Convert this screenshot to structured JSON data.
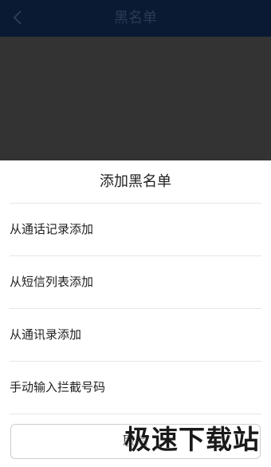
{
  "header": {
    "title": "黑名单",
    "back_icon": "chevron-left-icon"
  },
  "sheet": {
    "title": "添加黑名单",
    "options": [
      {
        "label": "从通话记录添加"
      },
      {
        "label": "从短信列表添加"
      },
      {
        "label": "从通讯录添加"
      },
      {
        "label": "手动输入拦截号码"
      }
    ],
    "cancel_label": "取消"
  },
  "watermark": {
    "text": "极速下载站"
  },
  "colors": {
    "top_bar": "#0a1a33",
    "overlay": "#333333",
    "sheet_bg": "#ffffff",
    "divider": "#e6e6e6"
  }
}
